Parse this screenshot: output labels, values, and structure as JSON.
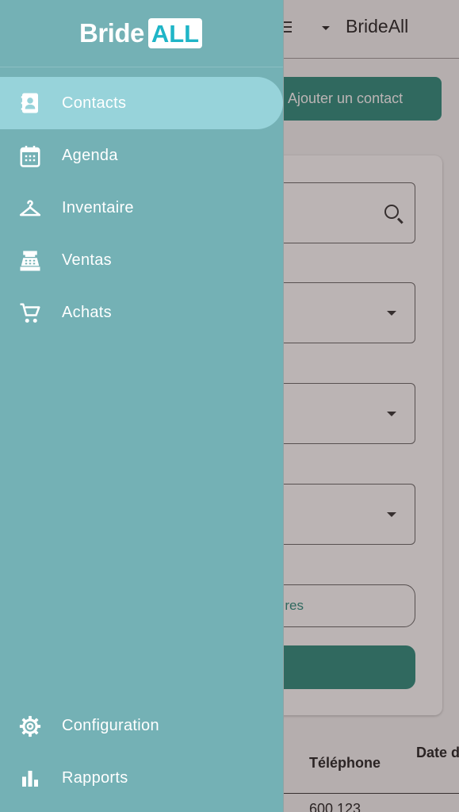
{
  "drawer": {
    "logo": {
      "bride": "Bride",
      "all": "ALL"
    },
    "items": [
      {
        "label": "Contacts",
        "icon": "contact-book-icon",
        "active": true
      },
      {
        "label": "Agenda",
        "icon": "calendar-icon",
        "active": false
      },
      {
        "label": "Inventaire",
        "icon": "hanger-icon",
        "active": false
      },
      {
        "label": "Ventas",
        "icon": "cash-register-icon",
        "active": false
      },
      {
        "label": "Achats",
        "icon": "shopping-cart-icon",
        "active": false
      }
    ],
    "bottom_items": [
      {
        "label": "Configuration",
        "icon": "gear-icon"
      },
      {
        "label": "Rapports",
        "icon": "bar-chart-icon"
      }
    ]
  },
  "background": {
    "brand_name": "BrideAll",
    "add_contact_label": "Ajouter un contact",
    "more_filters_label": "res",
    "table": {
      "columns": [
        "Téléphone",
        "Date de l'év"
      ],
      "first_phone": "600 123"
    }
  },
  "colors": {
    "drawer_bg": "#74b1b5",
    "active_item_bg": "#97d3da",
    "accent": "#2a8c7d",
    "logo_all_text": "#1fb5c7"
  }
}
